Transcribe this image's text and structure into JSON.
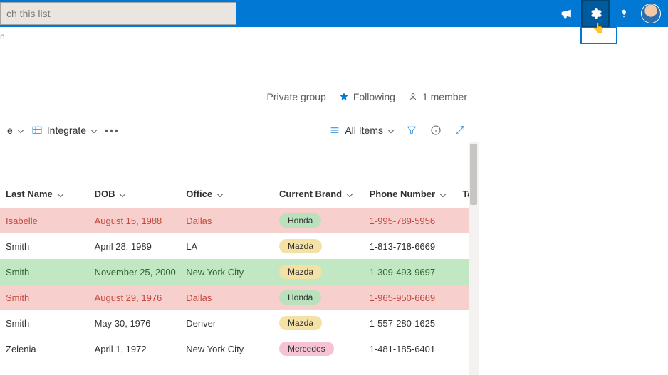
{
  "search": {
    "placeholder": "Search this list",
    "partial_visible": "ch this list"
  },
  "truncated_below_bar": "n",
  "list_header": {
    "privacy": "Private group",
    "following_label": "Following",
    "members_text": "1 member"
  },
  "command_bar": {
    "btn_e_trailing": "e",
    "integrate_label": "Integrate",
    "view_name": "All Items"
  },
  "columns": {
    "last_name": "Last Name",
    "dob": "DOB",
    "office": "Office",
    "brand": "Current Brand",
    "phone": "Phone Number",
    "ta": "Ta"
  },
  "rows": [
    {
      "last": "Isabelle",
      "dob": "August 15, 1988",
      "office": "Dallas",
      "brand": "Honda",
      "phone": "1-995-789-5956",
      "row_class": "row-pink",
      "brand_class": "brand-honda"
    },
    {
      "last": "Smith",
      "dob": "April 28, 1989",
      "office": "LA",
      "brand": "Mazda",
      "phone": "1-813-718-6669",
      "row_class": "row-white",
      "brand_class": "brand-mazda"
    },
    {
      "last": "Smith",
      "dob": "November 25, 2000",
      "office": "New York City",
      "brand": "Mazda",
      "phone": "1-309-493-9697",
      "row_class": "row-green",
      "brand_class": "brand-mazda"
    },
    {
      "last": "Smith",
      "dob": "August 29, 1976",
      "office": "Dallas",
      "brand": "Honda",
      "phone": "1-965-950-6669",
      "row_class": "row-pink",
      "brand_class": "brand-honda"
    },
    {
      "last": "Smith",
      "dob": "May 30, 1976",
      "office": "Denver",
      "brand": "Mazda",
      "phone": "1-557-280-1625",
      "row_class": "row-white",
      "brand_class": "brand-mazda"
    },
    {
      "last": "Zelenia",
      "dob": "April 1, 1972",
      "office": "New York City",
      "brand": "Mercedes",
      "phone": "1-481-185-6401",
      "row_class": "row-white",
      "brand_class": "brand-mercedes"
    }
  ]
}
